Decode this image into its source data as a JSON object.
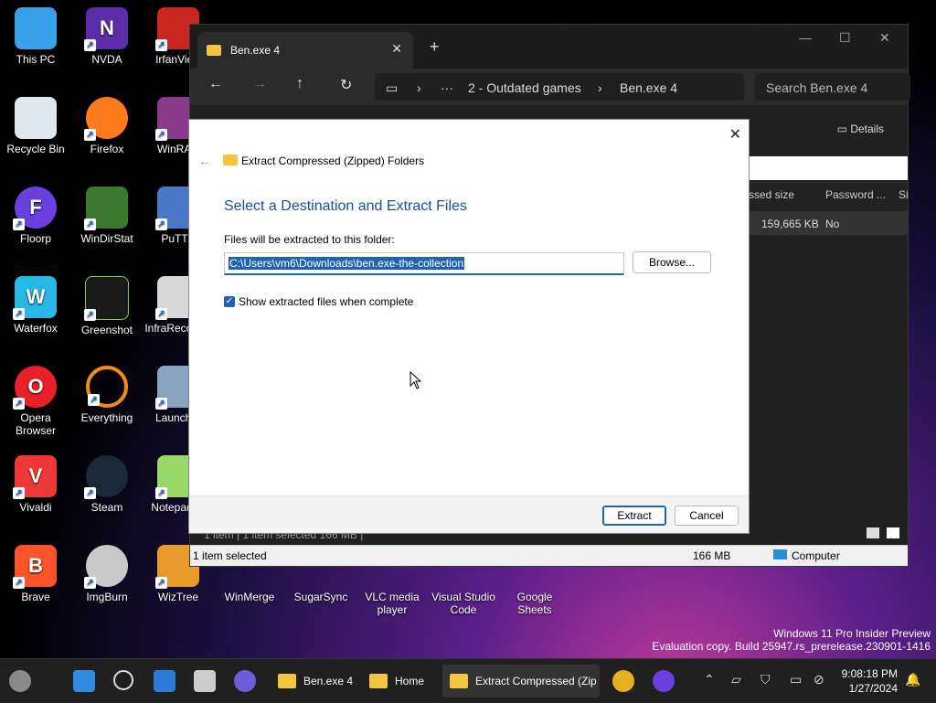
{
  "desktop": {
    "icons": [
      {
        "label": "This PC"
      },
      {
        "label": "NVDA"
      },
      {
        "label": "IrfanView"
      },
      {
        "label": "Recycle Bin"
      },
      {
        "label": "Firefox"
      },
      {
        "label": "WinRAR"
      },
      {
        "label": "Floorp"
      },
      {
        "label": "WinDirStat"
      },
      {
        "label": "PuTTY"
      },
      {
        "label": "Waterfox"
      },
      {
        "label": "Greenshot"
      },
      {
        "label": "InfraRecorder"
      },
      {
        "label": "Opera Browser"
      },
      {
        "label": "Everything"
      },
      {
        "label": "Launcher"
      },
      {
        "label": "Vivaldi"
      },
      {
        "label": "Steam"
      },
      {
        "label": "Notepad++"
      },
      {
        "label": "Brave"
      },
      {
        "label": "ImgBurn"
      },
      {
        "label": "WizTree"
      },
      {
        "label": "WinMerge"
      },
      {
        "label": "SugarSync"
      },
      {
        "label": "VLC media player"
      },
      {
        "label": "Visual Studio Code"
      },
      {
        "label": "Google Sheets"
      }
    ],
    "watermark_line1": "Windows 11 Pro Insider Preview",
    "watermark_line2": "Evaluation copy. Build 25947.rs_prerelease.230901-1416"
  },
  "explorer": {
    "tab_title": "Ben.exe 4",
    "breadcrumb": [
      "2 - Outdated games",
      "Ben.exe 4"
    ],
    "search_placeholder": "Search Ben.exe 4",
    "details_label": "Details",
    "columns": [
      "ssed size",
      "Password ...",
      "Si"
    ],
    "row": {
      "compressed": "159,665 KB",
      "password": "No"
    },
    "status_left": "1 item selected",
    "status_size": "166 MB",
    "status_location": "Computer",
    "ghost_status": "1 item   |   1 item selected  166 MB  |"
  },
  "dialog": {
    "caption": "Extract Compressed (Zipped) Folders",
    "heading": "Select a Destination and Extract Files",
    "folder_label": "Files will be extracted to this folder:",
    "path_value": "C:\\Users\\vm6\\Downloads\\ben.exe-the-collection",
    "browse_label": "Browse...",
    "checkbox_label": "Show extracted files when complete",
    "checkbox_checked": true,
    "extract_label": "Extract",
    "cancel_label": "Cancel"
  },
  "taskbar": {
    "apps": [
      {
        "label": "Ben.exe 4"
      },
      {
        "label": "Home"
      },
      {
        "label": "Extract Compressed (Zip"
      }
    ],
    "time": "9:08:18 PM",
    "date": "1/27/2024"
  }
}
